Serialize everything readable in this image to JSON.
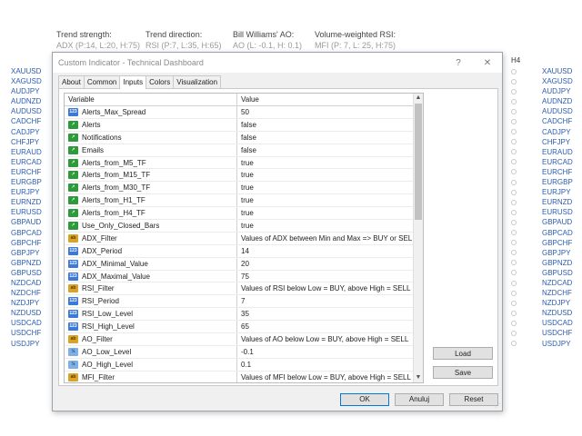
{
  "header": [
    {
      "title": "Trend strength:",
      "sub": "ADX (P:14, L:20, H:75)"
    },
    {
      "title": "Trend direction:",
      "sub": "RSI (P:7, L:35, H:65)"
    },
    {
      "title": "Bill Williams' AO:",
      "sub": "AO (L: -0.1, H: 0.1)"
    },
    {
      "title": "Volume-weighted RSI:",
      "sub": "MFI (P: 7, L: 25, H:75)"
    }
  ],
  "timeframe_label": "H4",
  "symbols": [
    "XAUUSD",
    "XAGUSD",
    "AUDJPY",
    "AUDNZD",
    "AUDUSD",
    "CADCHF",
    "CADJPY",
    "CHFJPY",
    "EURAUD",
    "EURCAD",
    "EURCHF",
    "EURGBP",
    "EURJPY",
    "EURNZD",
    "EURUSD",
    "GBPAUD",
    "GBPCAD",
    "GBPCHF",
    "GBPJPY",
    "GBPNZD",
    "GBPUSD",
    "NZDCAD",
    "NZDCHF",
    "NZDJPY",
    "NZDUSD",
    "USDCAD",
    "USDCHF",
    "USDJPY"
  ],
  "right_symbols": [
    "XAUUSD",
    "XAGUSD",
    "AUDJPY",
    "AUDNZD",
    "AUDUSD",
    "CADCHF",
    "CADJPY",
    "CHFJPY",
    "EURAUD",
    "EURCAD",
    "EURCHF",
    "EURGBP",
    "EURJPY",
    "EURNZD",
    "EURUSD",
    "GBPAUD",
    "GBPCAD",
    "GBPCHF",
    "GBPJPY",
    "GBPNZD",
    "GBPUSD",
    "NZDCAD",
    "NZDCHF",
    "NZDJPY",
    "NZDUSD",
    "USDCAD",
    "USDCHF",
    "USDJPY"
  ],
  "dialog": {
    "title": "Custom Indicator - Technical Dashboard",
    "help_label": "?",
    "close_label": "✕",
    "tabs": [
      "About",
      "Common",
      "Inputs",
      "Colors",
      "Visualization"
    ],
    "active_tab": "Inputs",
    "columns": {
      "variable": "Variable",
      "value": "Value"
    },
    "rows": [
      {
        "type": "num",
        "name": "Alerts_Max_Spread",
        "value": "50"
      },
      {
        "type": "bool",
        "name": "Alerts",
        "value": "false"
      },
      {
        "type": "bool",
        "name": "Notifications",
        "value": "false"
      },
      {
        "type": "bool",
        "name": "Emails",
        "value": "false"
      },
      {
        "type": "bool",
        "name": "Alerts_from_M5_TF",
        "value": "true"
      },
      {
        "type": "bool",
        "name": "Alerts_from_M15_TF",
        "value": "true"
      },
      {
        "type": "bool",
        "name": "Alerts_from_M30_TF",
        "value": "true"
      },
      {
        "type": "bool",
        "name": "Alerts_from_H1_TF",
        "value": "true"
      },
      {
        "type": "bool",
        "name": "Alerts_from_H4_TF",
        "value": "true"
      },
      {
        "type": "bool",
        "name": "Use_Only_Closed_Bars",
        "value": "true"
      },
      {
        "type": "str",
        "name": "ADX_Filter",
        "value": "Values of ADX between Min and Max => BUY or SELL"
      },
      {
        "type": "num",
        "name": "ADX_Period",
        "value": "14"
      },
      {
        "type": "num",
        "name": "ADX_Minimal_Value",
        "value": "20"
      },
      {
        "type": "num",
        "name": "ADX_Maximal_Value",
        "value": "75"
      },
      {
        "type": "str",
        "name": "RSI_Filter",
        "value": "Values of RSI below Low = BUY, above High = SELL"
      },
      {
        "type": "num",
        "name": "RSI_Period",
        "value": "7"
      },
      {
        "type": "num",
        "name": "RSI_Low_Level",
        "value": "35"
      },
      {
        "type": "num",
        "name": "RSI_High_Level",
        "value": "65"
      },
      {
        "type": "str",
        "name": "AO_Filter",
        "value": "Values of AO below Low = BUY, above High = SELL"
      },
      {
        "type": "dbl",
        "name": "AO_Low_Level",
        "value": "-0.1"
      },
      {
        "type": "dbl",
        "name": "AO_High_Level",
        "value": "0.1"
      },
      {
        "type": "str",
        "name": "MFI_Filter",
        "value": "Values of MFI below Low = BUY, above High = SELL"
      }
    ],
    "load_label": "Load",
    "save_label": "Save",
    "ok_label": "OK",
    "cancel_label": "Anuluj",
    "reset_label": "Reset"
  }
}
